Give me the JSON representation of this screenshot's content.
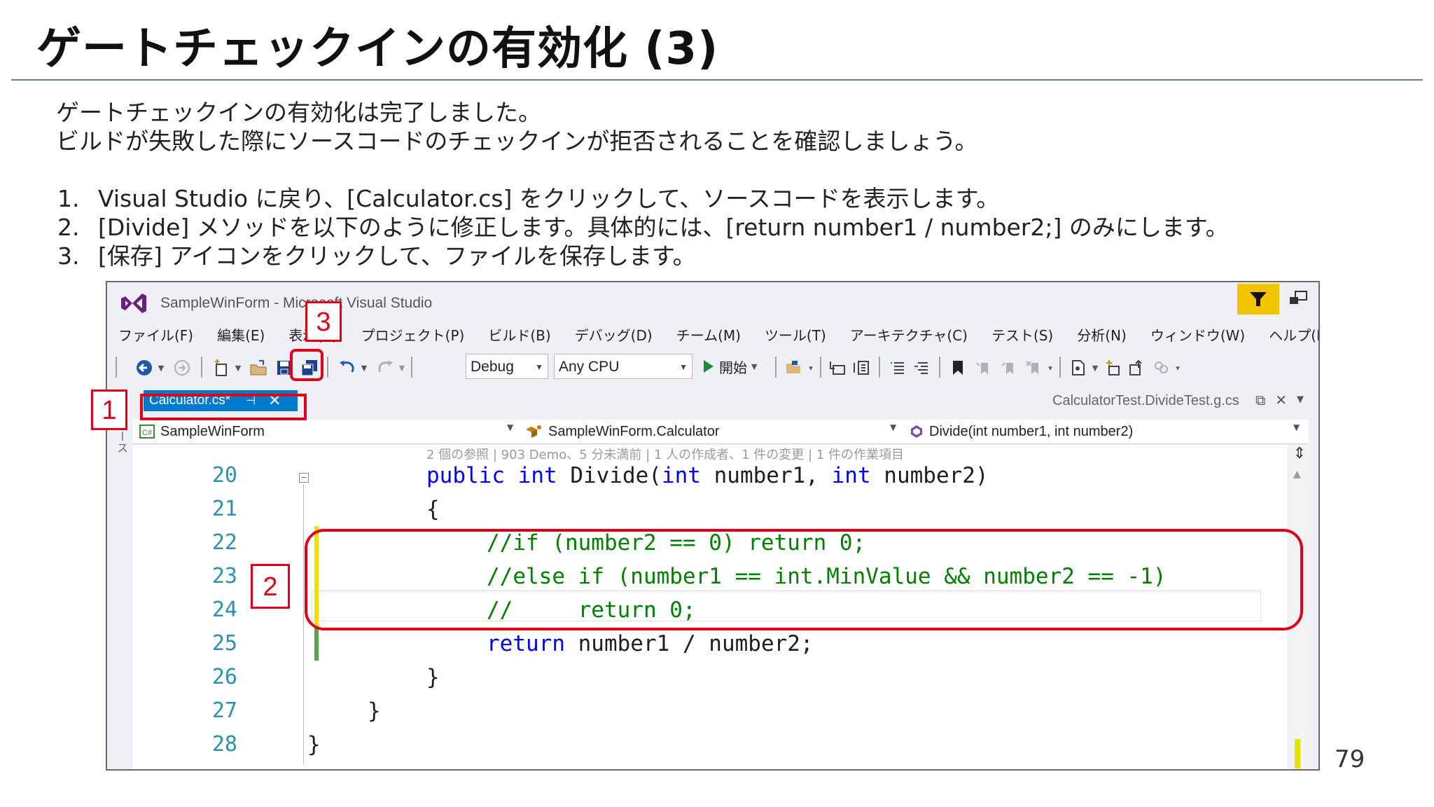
{
  "slide": {
    "title": "ゲートチェックインの有効化 (3)",
    "intro_lines": [
      "ゲートチェックインの有効化は完了しました。",
      "ビルドが失敗した際にソースコードのチェックインが拒否されることを確認しましょう。"
    ],
    "steps": [
      {
        "num": "1.",
        "text": "Visual Studio に戻り、[Calculator.cs] をクリックして、ソースコードを表示します。"
      },
      {
        "num": "2.",
        "text": "[Divide] メソッドを以下のように修正します。具体的には、[return number1 / number2;] のみにします。"
      },
      {
        "num": "3.",
        "text": "[保存] アイコンをクリックして、ファイルを保存します。"
      }
    ],
    "page_number": "79"
  },
  "vs": {
    "window_title": "SampleWinForm - Microsoft Visual Studio",
    "menu": [
      "ファイル(F)",
      "編集(E)",
      "表示(V)",
      "プロジェクト(P)",
      "ビルド(B)",
      "デバッグ(D)",
      "チーム(M)",
      "ツール(T)",
      "アーキテクチャ(C)",
      "テスト(S)",
      "分析(N)",
      "ウィンドウ(W)",
      "ヘルプ(H)"
    ],
    "toolbar": {
      "config": "Debug",
      "platform": "Any CPU",
      "start": "開始"
    },
    "tabs": {
      "active": "Calculator.cs*",
      "right": "CalculatorTest.DivideTest.g.cs"
    },
    "side_strip": "ソース",
    "nav": {
      "project": "SampleWinForm",
      "class": "SampleWinForm.Calculator",
      "member": "Divide(int number1, int number2)"
    },
    "codelens": "2 個の参照 | 903 Demo、5 分未満前 | 1 人の作成者、1 件の変更 | 1 件の作業項目",
    "line_numbers": [
      "20",
      "21",
      "22",
      "23",
      "24",
      "25",
      "26",
      "27",
      "28"
    ],
    "code": {
      "l20_kw1": "public",
      "l20_kw2": "int",
      "l20_name": "Divide(",
      "l20_kw3": "int",
      "l20_p1": " number1, ",
      "l20_kw4": "int",
      "l20_p2": " number2)",
      "l21": "{",
      "l22": "//if (number2 == 0) return 0;",
      "l23": "//else if (number1 == int.MinValue && number2 == -1)",
      "l24": "//     return 0;",
      "l25_kw": "return",
      "l25_rest": " number1 / number2;",
      "l26": "}",
      "l27": "}",
      "l28": "}"
    },
    "colors": {
      "accent": "#007acc",
      "keyword": "#0000ff",
      "comment": "#008000",
      "line_number": "#2b91af",
      "annotation": "#e0001a",
      "change_saved": "#57a64a",
      "change_unsaved": "#efe000"
    }
  },
  "annotations": [
    "1",
    "2",
    "3"
  ]
}
